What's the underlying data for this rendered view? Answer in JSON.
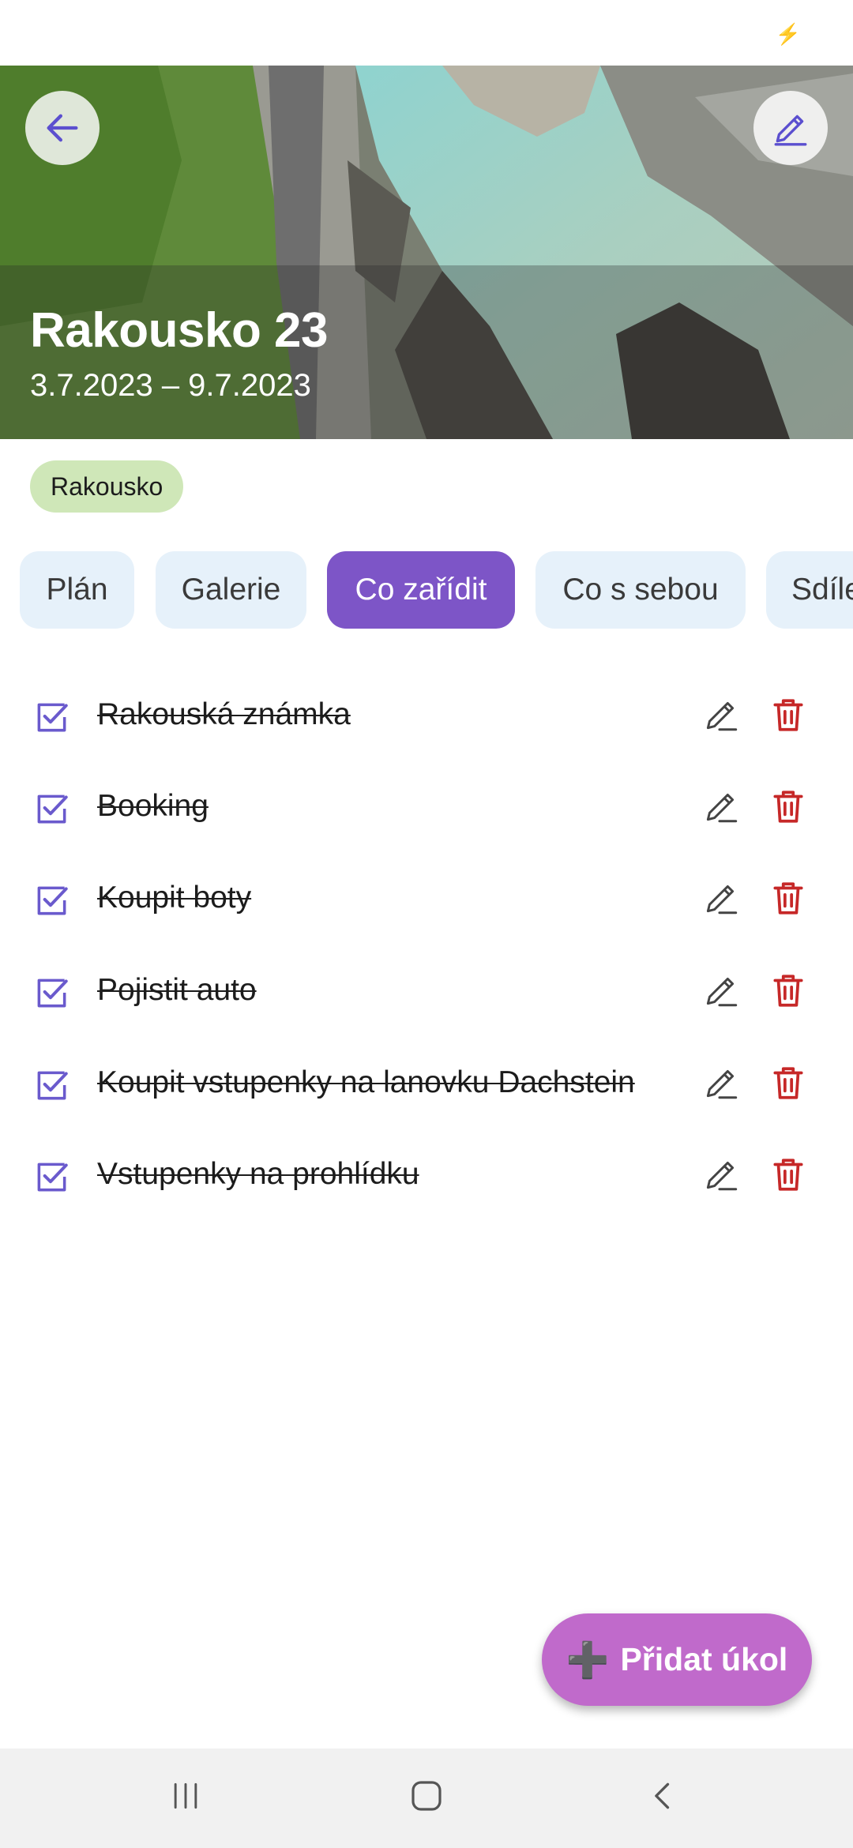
{
  "trip": {
    "title": "Rakousko 23",
    "dates": "3.7.2023 – 9.7.2023",
    "tag": "Rakousko"
  },
  "tabs": [
    {
      "label": "Plán",
      "active": false
    },
    {
      "label": "Galerie",
      "active": false
    },
    {
      "label": "Co zařídit",
      "active": true
    },
    {
      "label": "Co s sebou",
      "active": false
    },
    {
      "label": "Sdíle",
      "active": false
    }
  ],
  "tasks": [
    {
      "label": "Rakouská známka",
      "done": true
    },
    {
      "label": "Booking",
      "done": true
    },
    {
      "label": "Koupit boty",
      "done": true
    },
    {
      "label": "Pojistit auto",
      "done": true
    },
    {
      "label": "Koupit vstupenky na lanovku Dachstein",
      "done": true
    },
    {
      "label": "Vstupenky na prohlídku",
      "done": true
    }
  ],
  "fab": {
    "icon": "plus-icon",
    "label": "Přidat úkol"
  },
  "icons": {
    "back": "arrow-left-icon",
    "edit": "pencil-icon",
    "status": "charging-bolt-icon"
  },
  "colors": {
    "accent": "#7d55c7",
    "fab": "#c06acb",
    "delete": "#c62828",
    "checkbox": "#6a5acd",
    "tag": "#cfe7b8",
    "tab_inactive": "#e6f1fa"
  }
}
